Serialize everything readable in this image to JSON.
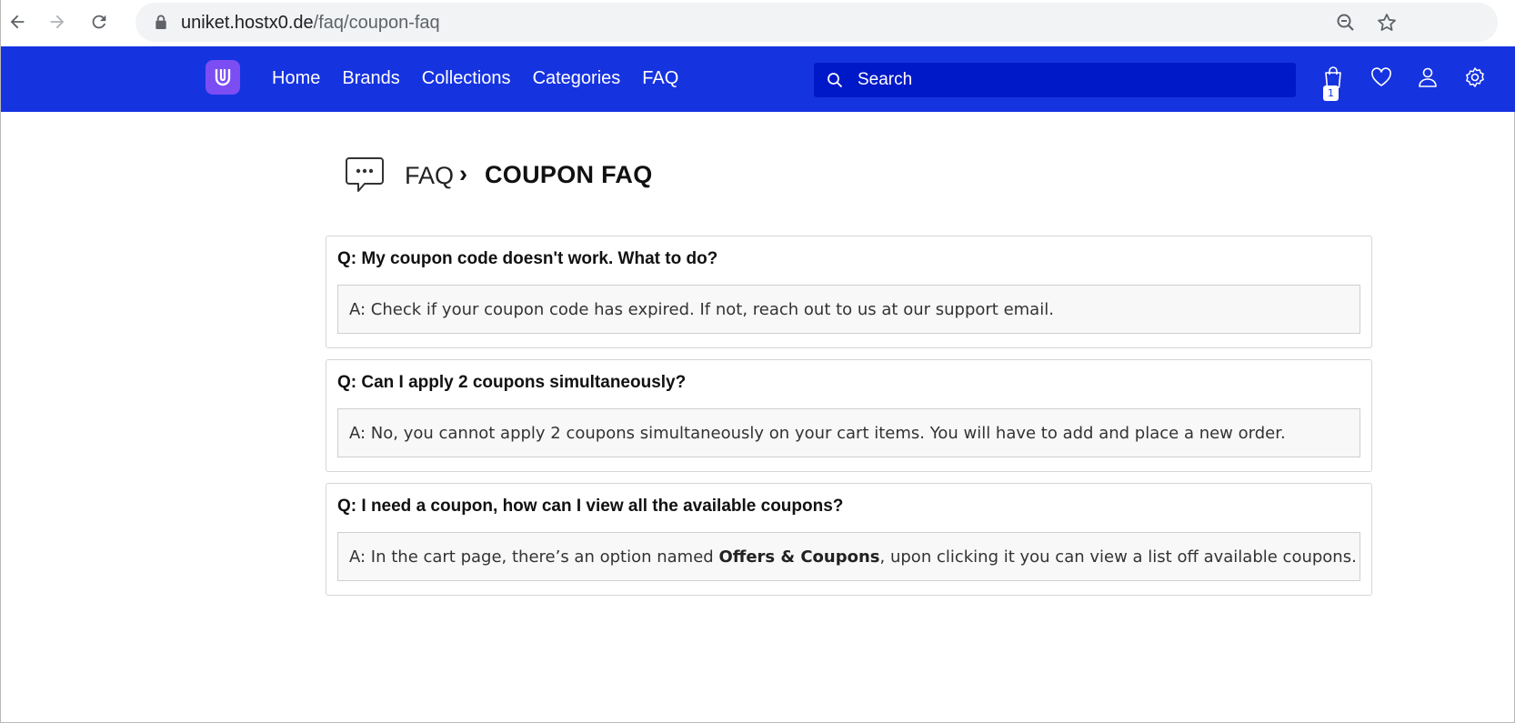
{
  "browser": {
    "url_host": "uniket.hostx0.de",
    "url_path": "/faq/coupon-faq",
    "icons": [
      "back-icon",
      "forward-icon",
      "reload-icon",
      "lock-icon",
      "zoom-icon",
      "star-icon"
    ]
  },
  "header": {
    "brand_color": "#1633e0",
    "logo_color": "#7b4df2",
    "nav": [
      "Home",
      "Brands",
      "Collections",
      "Categories",
      "FAQ"
    ],
    "search_placeholder": "Search",
    "cart_count": "1",
    "icons": [
      "search-icon",
      "cart-icon",
      "heart-icon",
      "user-icon",
      "settings-icon"
    ]
  },
  "breadcrumb": {
    "parent": "FAQ",
    "separator": "›",
    "current": "COUPON FAQ"
  },
  "faqs": [
    {
      "question": "Q: My coupon code doesn't work. What to do?",
      "answer_prefix": "A: Check if your coupon code has expired. If not, reach out to us at our support email.",
      "answer_bold": "",
      "answer_suffix": ""
    },
    {
      "question": "Q: Can I apply 2 coupons simultaneously?",
      "answer_prefix": "A: No, you cannot apply 2 coupons simultaneously on your cart items. You will have to add and place a new order.",
      "answer_bold": "",
      "answer_suffix": ""
    },
    {
      "question": "Q: I need a coupon, how can I view all the available coupons?",
      "answer_prefix": "A: In the cart page, there’s an option named ",
      "answer_bold": "Offers & Coupons",
      "answer_suffix": ", upon clicking it you can view a list off available coupons."
    }
  ]
}
